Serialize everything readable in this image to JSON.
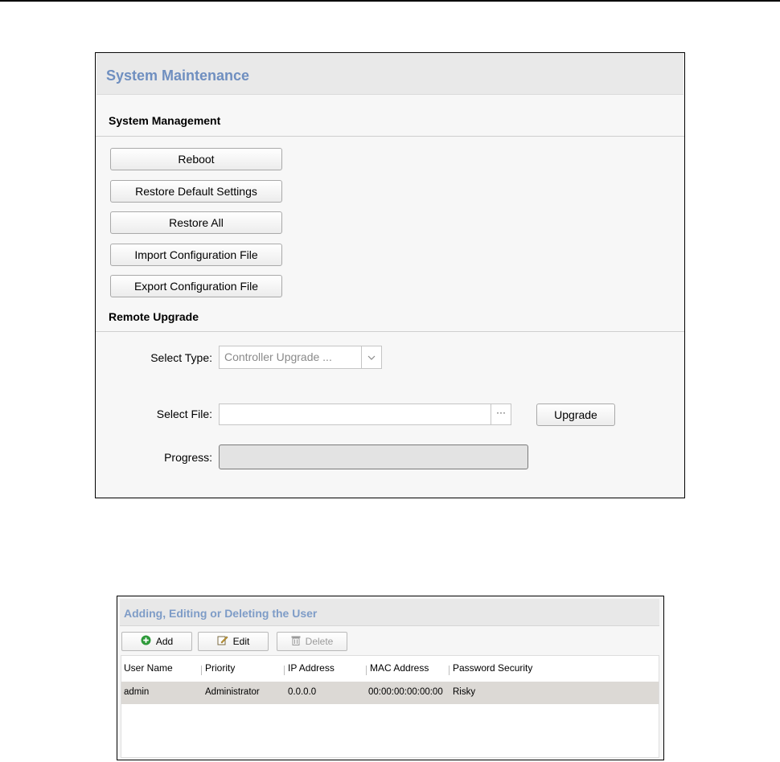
{
  "maintenance": {
    "title": "System Maintenance",
    "system_management": {
      "heading": "System Management",
      "buttons": {
        "reboot": "Reboot",
        "restore_default": "Restore Default Settings",
        "restore_all": "Restore All",
        "import_config": "Import Configuration File",
        "export_config": "Export Configuration File"
      }
    },
    "remote_upgrade": {
      "heading": "Remote Upgrade",
      "select_type_label": "Select Type:",
      "select_type_value": "Controller Upgrade ...",
      "select_file_label": "Select File:",
      "select_file_value": "",
      "browse_label": "···",
      "upgrade_button": "Upgrade",
      "progress_label": "Progress:",
      "progress_value": 0
    }
  },
  "users": {
    "title": "Adding, Editing or Deleting the User",
    "toolbar": {
      "add": "Add",
      "edit": "Edit",
      "delete": "Delete"
    },
    "columns": [
      "User Name",
      "Priority",
      "IP Address",
      "MAC Address",
      "Password Security"
    ],
    "rows": [
      {
        "user_name": "admin",
        "priority": "Administrator",
        "ip": "0.0.0.0",
        "mac": "00:00:00:00:00:00",
        "password_security": "Risky"
      }
    ]
  }
}
